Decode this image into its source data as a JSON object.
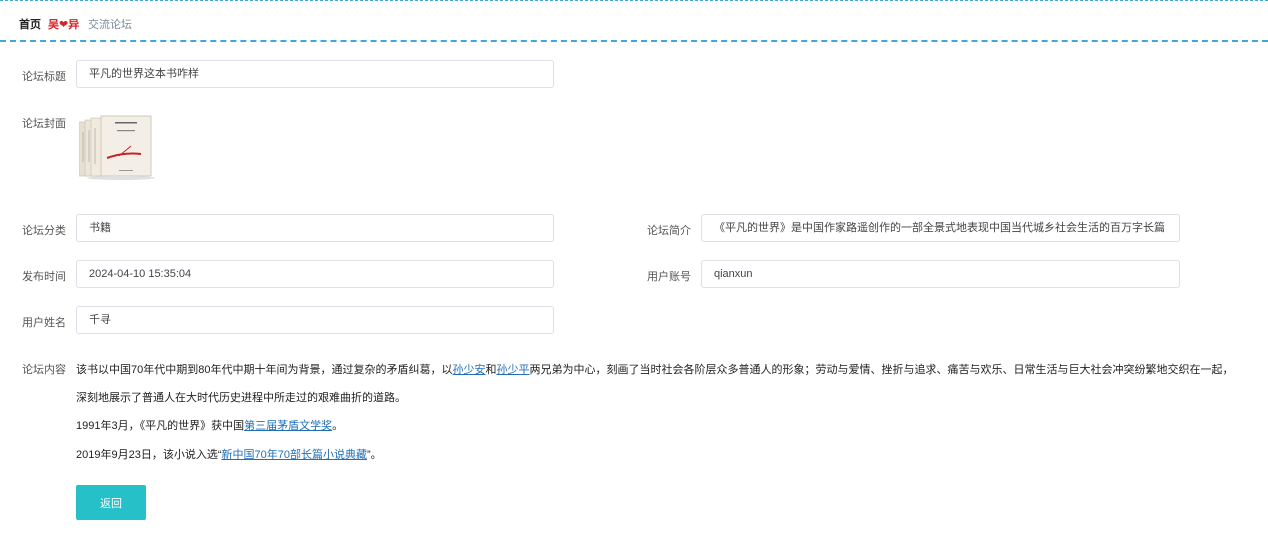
{
  "breadcrumb": {
    "home": "首页",
    "separator": "吴❤异",
    "current": "交流论坛"
  },
  "form": {
    "title_label": "论坛标题",
    "title_value": "平凡的世界这本书咋样",
    "cover_label": "论坛封面",
    "category_label": "论坛分类",
    "category_value": "书籍",
    "intro_label": "论坛简介",
    "intro_value": "《平凡的世界》是中国作家路遥创作的一部全景式地表现中国当代城乡社会生活的百万字长篇",
    "time_label": "发布时间",
    "time_value": "2024-04-10 15:35:04",
    "account_label": "用户账号",
    "account_value": "qianxun",
    "name_label": "用户姓名",
    "name_value": "千寻",
    "content_label": "论坛内容"
  },
  "content": {
    "p1_a": "该书以中国70年代中期到80年代中期十年间为背景，通过复杂的矛盾纠葛，以",
    "p1_link1": "孙少安",
    "p1_b": "和",
    "p1_link2": "孙少平",
    "p1_c": "两兄弟为中心，刻画了当时社会各阶层众多普通人的形象；劳动与爱情、挫折与追求、痛苦与欢乐、日常生活与巨大社会冲突纷繁地交织在一起，",
    "p2": "深刻地展示了普通人在大时代历史进程中所走过的艰难曲折的道路。",
    "p3_a": "1991年3月，《平凡的世界》获中国",
    "p3_link": "第三届茅盾文学奖",
    "p3_b": "。",
    "p4_a": "2019年9月23日，该小说入选“",
    "p4_link": "新中国70年70部长篇小说典藏",
    "p4_b": "”。"
  },
  "actions": {
    "back_label": "返回"
  },
  "colors": {
    "accent": "#26c0c8",
    "border_dashed": "#3ea8d8",
    "link": "#1f6fb8"
  }
}
